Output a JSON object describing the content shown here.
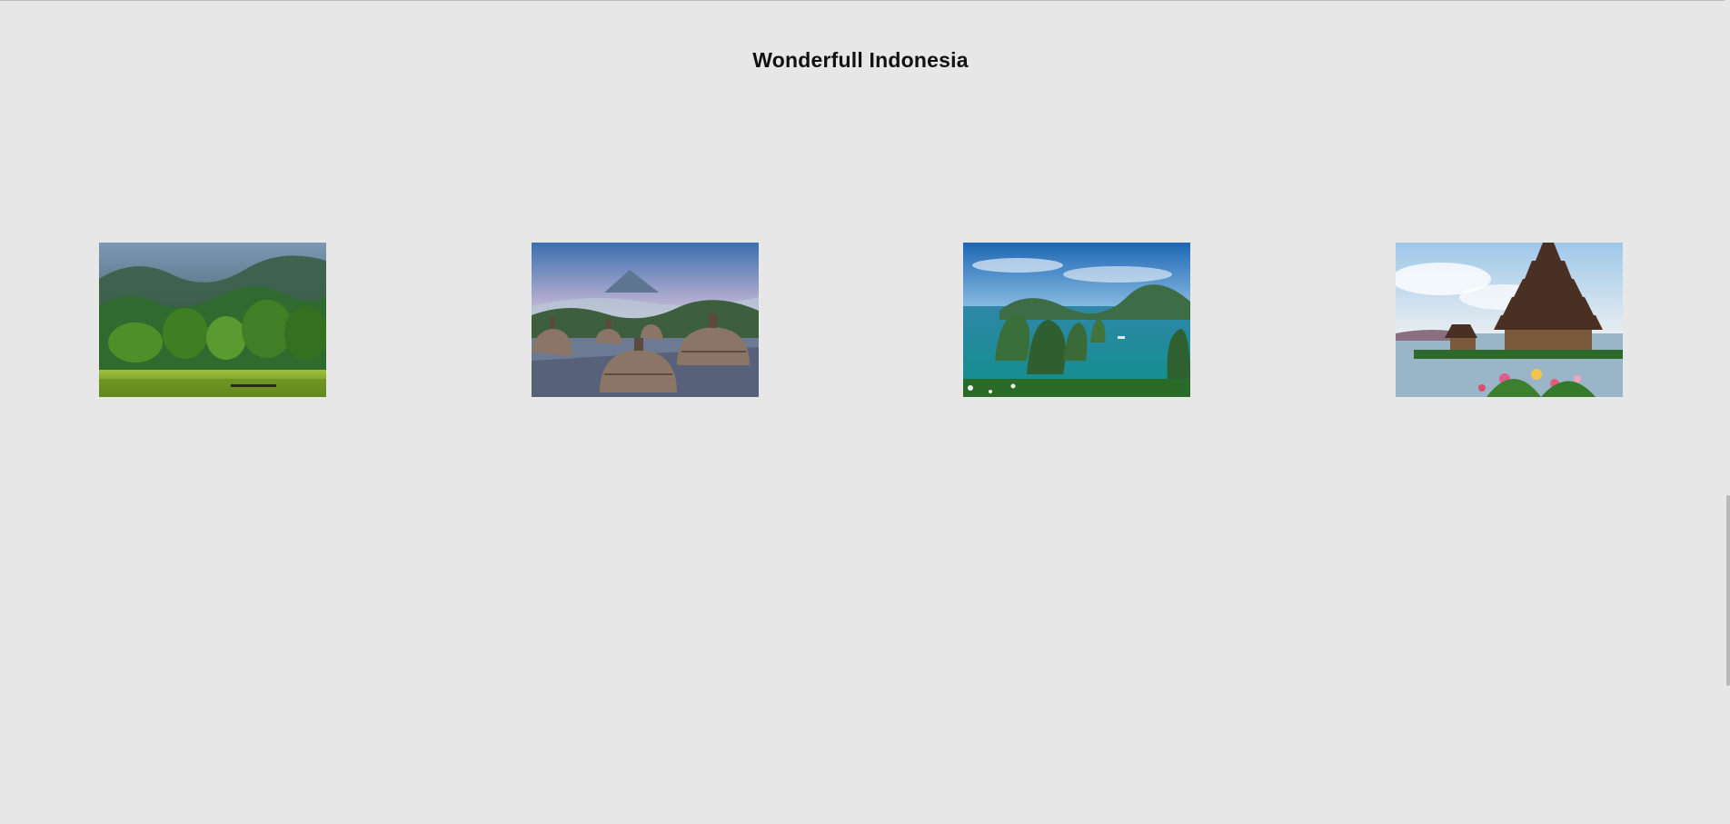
{
  "page": {
    "title": "Wonderfull Indonesia"
  },
  "gallery": {
    "items": [
      {
        "subject": "rice-field-forest"
      },
      {
        "subject": "borobudur-temple"
      },
      {
        "subject": "raja-ampat-islands"
      },
      {
        "subject": "ulun-danu-temple"
      }
    ]
  },
  "colors": {
    "background": "#e7e7e7",
    "title": "#111111",
    "scroll_thumb": "#b9b9b9"
  }
}
